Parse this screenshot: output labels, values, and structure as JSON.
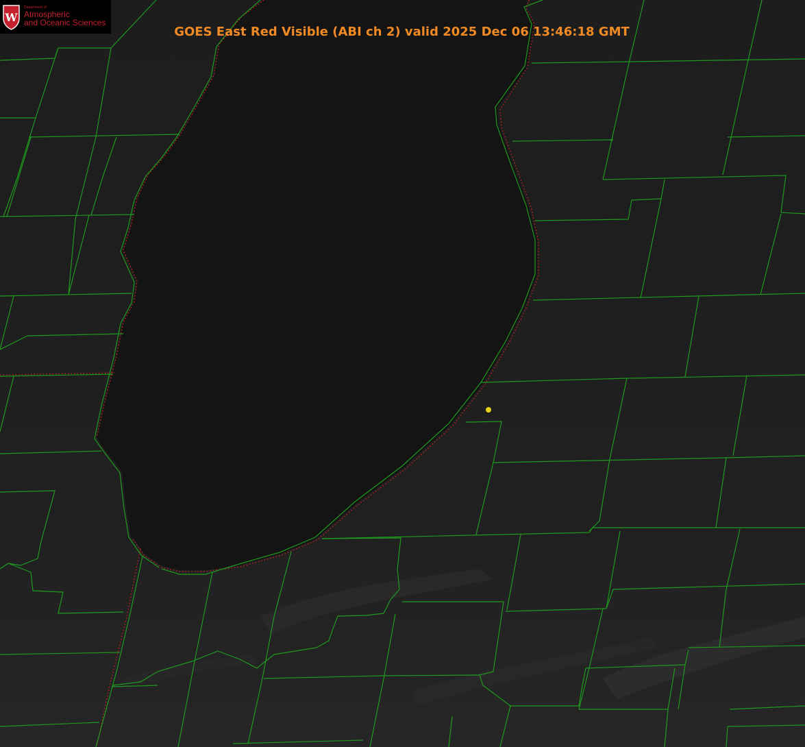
{
  "title": "GOES East Red Visible (ABI ch 2) valid 2025 Dec 06 13:46:18 GMT",
  "logo": {
    "department_label": "Department of",
    "line1": "Atmospheric",
    "line2": "and Oceanic Sciences",
    "crest_letter": "W",
    "crest_icon": "university-crest-icon"
  },
  "colors": {
    "background": "#1c1c1c",
    "lake": "#141414",
    "county_lines": "#1f9a1f",
    "state_line": "#d42020",
    "title": "#f08a24",
    "marker": "#e8d21a",
    "logo_text": "#c5202e"
  },
  "marker": {
    "icon": "yellow-dot-marker-icon"
  }
}
